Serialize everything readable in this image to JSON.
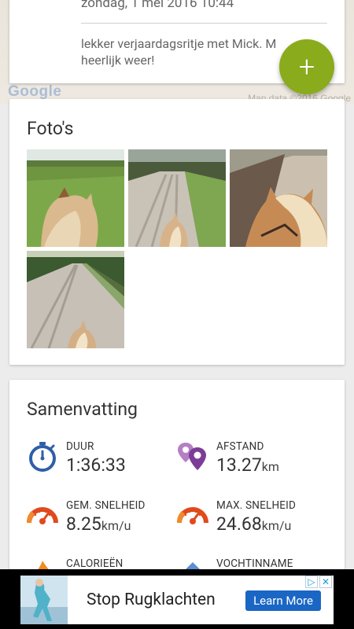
{
  "map": {
    "logo_text": "Google",
    "attribution": "Map data ©2016 Google"
  },
  "note": {
    "date": "zondag, 1 mei 2016 10:44",
    "text": "lekker verjaardagsritje met Mick. M heerlijk weer!"
  },
  "fab": {
    "label": "+",
    "icon": "plus-icon",
    "color": "#8aab1c"
  },
  "photos": {
    "title": "Foto's",
    "items": [
      "photo-1",
      "photo-2",
      "photo-3",
      "photo-4"
    ]
  },
  "summary": {
    "title": "Samenvatting",
    "stats": [
      {
        "label": "DUUR",
        "value": "1:36:33",
        "unit": "",
        "icon": "stopwatch-icon"
      },
      {
        "label": "AFSTAND",
        "value": "13.27",
        "unit": "km",
        "icon": "map-pins-icon"
      },
      {
        "label": "GEM. SNELHEID",
        "value": "8.25",
        "unit": "km/u",
        "icon": "speedometer-icon"
      },
      {
        "label": "MAX. SNELHEID",
        "value": "24.68",
        "unit": "km/u",
        "icon": "speedometer-icon"
      },
      {
        "label": "CALORIEËN",
        "value": "",
        "unit": "",
        "icon": "flame-icon"
      },
      {
        "label": "VOCHTINNAME",
        "value": "",
        "unit": "",
        "icon": "water-drop-icon"
      }
    ]
  },
  "ad": {
    "text": "Stop Rugklachten",
    "button": "Learn More",
    "choices_icon": "ad-choices-icon",
    "close_label": "✕"
  },
  "colors": {
    "accent_green": "#8aab1c",
    "stopwatch_blue": "#2f5fa8",
    "pin_purple": "#7b3d97",
    "speed_red": "#e04a1c",
    "ad_button_blue": "#1a66c4"
  }
}
